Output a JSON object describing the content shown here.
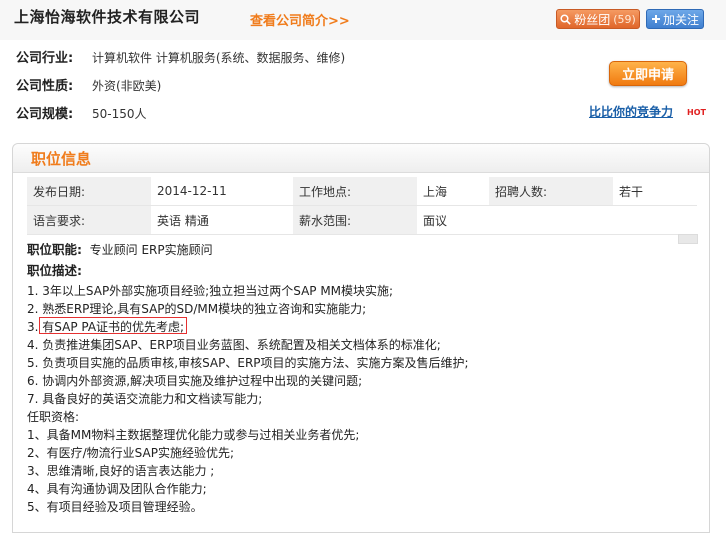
{
  "header": {
    "company_name": "上海怡海软件技术有限公司",
    "intro_link": "查看公司简介>>",
    "fans_label": "粉丝团",
    "fans_count": "(59)",
    "follow_label": "加关注",
    "fans_icon": "search-icon",
    "follow_icon": "plus-icon"
  },
  "company": {
    "industry_label": "公司行业:",
    "industry_value": "计算机软件   计算机服务(系统、数据服务、维修)",
    "nature_label": "公司性质:",
    "nature_value": "外资(非欧美)",
    "size_label": "公司规模:",
    "size_value": "50-150人"
  },
  "actions": {
    "apply_label": "立即申请",
    "compete_link": "比比你的竞争力",
    "hot_badge": "HOT"
  },
  "panel": {
    "title": "职位信息"
  },
  "details": {
    "date_label": "发布日期:",
    "date_value": "2014-12-11",
    "location_label": "工作地点:",
    "location_value": "上海",
    "headcount_label": "招聘人数:",
    "headcount_value": "若干",
    "language_label": "语言要求:",
    "language_value": "英语 精通",
    "salary_label": "薪水范围:",
    "salary_value": "面议"
  },
  "description": {
    "function_label": "职位职能:",
    "function_value": "专业顾问  ERP实施顾问",
    "desc_label": "职位描述:",
    "duties": [
      "1. 3年以上SAP外部实施项目经验;独立担当过两个SAP MM模块实施;",
      "2. 熟悉ERP理论,具有SAP的SD/MM模块的独立咨询和实施能力;",
      "3. 有SAP PA证书的优先考虑;",
      "4. 负责推进集团SAP、ERP项目业务蓝图、系统配置及相关文档体系的标准化;",
      "5. 负责项目实施的品质审核,审核SAP、ERP项目的实施方法、实施方案及售后维护;",
      "6. 协调内外部资源,解决项目实施及维护过程中出现的关键问题;",
      "7. 具备良好的英语交流能力和文档读写能力;"
    ],
    "req_label": "任职资格:",
    "requirements": [
      "1、具备MM物料主数据整理优化能力或参与过相关业务者优先;",
      "2、有医疗/物流行业SAP实施经验优先;",
      "3、思维清晰,良好的语言表达能力 ;",
      "4、具有沟通协调及团队合作能力;",
      "5、有项目经验及项目管理经验。"
    ]
  },
  "colors": {
    "accent_orange": "#f07c1c",
    "link_blue": "#1a5fa8",
    "highlight_red": "#e53030"
  }
}
